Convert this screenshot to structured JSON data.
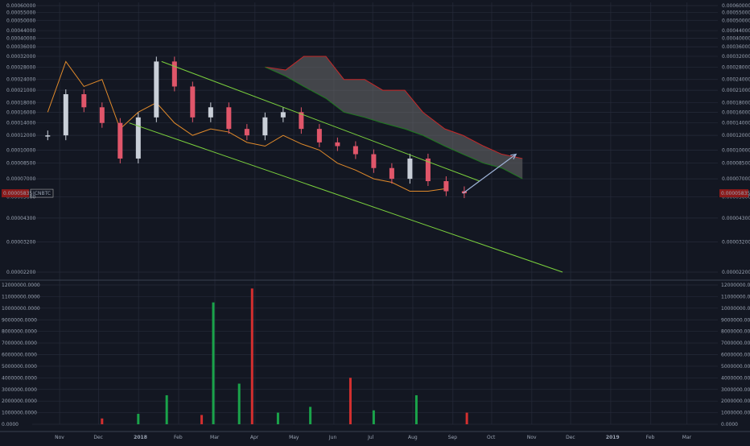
{
  "symbol": "ICNBTC",
  "last_price_label": "0.00005835",
  "colors": {
    "background": "#131722",
    "grid": "#262b3a",
    "bull": "#1aa34a",
    "bear": "#d32f2f",
    "candle_bull": "#c9cfd8",
    "candle_bear": "#e0566a",
    "orange_line": "#e08a2b",
    "trendline": "#7bd13d",
    "cloud_fill": "#6b6b6b",
    "cloud_edge_upper": "#c62828",
    "cloud_edge_lower": "#1e7a1e",
    "projection_arrow": "#9fb4d8",
    "price_badge": "#8b1a1a"
  },
  "chart_data": [
    {
      "type": "line",
      "panel": "price",
      "scale": "log",
      "ylim": [
        2.2e-05,
        6e-05
      ],
      "y_ticks": [
        "0.00060000",
        "0.00055000",
        "0.00050000",
        "0.00044000",
        "0.00040000",
        "0.00036000",
        "0.00032000",
        "0.00028000",
        "0.00024000",
        "0.00021000",
        "0.00018000",
        "0.00016000",
        "0.00014000",
        "0.00012000",
        "0.00010000",
        "0.00008500",
        "0.00007000",
        "0.00005600",
        "0.00004300",
        "0.00003200",
        "0.00002200"
      ],
      "x_ticks": [
        "Nov",
        "Dec",
        "2018",
        "Feb",
        "Mar",
        "Apr",
        "May",
        "Jun",
        "Jul",
        "Aug",
        "Sep",
        "Oct",
        "Nov",
        "Dec",
        "2019",
        "Feb",
        "Mar"
      ],
      "series": [
        {
          "kind": "candles",
          "x": [
            "2017-10-29",
            "2017-11-12",
            "2017-11-26",
            "2017-12-10",
            "2017-12-24",
            "2018-01-07",
            "2018-01-21",
            "2018-02-04",
            "2018-02-18",
            "2018-03-04",
            "2018-03-18",
            "2018-04-01",
            "2018-04-15",
            "2018-04-29",
            "2018-05-13",
            "2018-05-27",
            "2018-06-10",
            "2018-06-24",
            "2018-07-08",
            "2018-07-22",
            "2018-08-05",
            "2018-08-19",
            "2018-09-02",
            "2018-09-16"
          ],
          "values": [
            0.00012,
            0.0002,
            0.00017,
            0.00014,
            9e-05,
            0.00015,
            0.0003,
            0.00022,
            0.00015,
            0.00017,
            0.00013,
            0.00012,
            0.00015,
            0.00016,
            0.00013,
            0.00011,
            0.000105,
            9.5e-05,
            8e-05,
            7e-05,
            9e-05,
            6.8e-05,
            6e-05,
            5.85e-05
          ]
        },
        {
          "kind": "line",
          "x": [
            "2017-10-29",
            "2017-11-12",
            "2017-11-26",
            "2017-12-10",
            "2017-12-24",
            "2018-01-07",
            "2018-01-21",
            "2018-02-04",
            "2018-02-18",
            "2018-03-04",
            "2018-03-18",
            "2018-04-01",
            "2018-04-15",
            "2018-04-29",
            "2018-05-13",
            "2018-05-27",
            "2018-06-10",
            "2018-06-24",
            "2018-07-08",
            "2018-07-22",
            "2018-08-05",
            "2018-08-19",
            "2018-09-02"
          ],
          "values": [
            0.00016,
            0.0003,
            0.00022,
            0.00024,
            0.00013,
            0.00016,
            0.00018,
            0.00014,
            0.00012,
            0.00013,
            0.000125,
            0.00011,
            0.000105,
            0.00012,
            0.000108,
            0.0001,
            8.5e-05,
            7.8e-05,
            7e-05,
            6.7e-05,
            6e-05,
            6e-05,
            6.2e-05
          ]
        },
        {
          "kind": "cloud",
          "x": [
            "2018-04-15",
            "2018-05-01",
            "2018-05-15",
            "2018-06-01",
            "2018-06-15",
            "2018-07-01",
            "2018-07-15",
            "2018-08-01",
            "2018-08-15",
            "2018-09-01",
            "2018-09-15",
            "2018-10-01",
            "2018-10-15",
            "2018-10-31"
          ],
          "upper": [
            0.00028,
            0.00027,
            0.00032,
            0.00032,
            0.00024,
            0.00024,
            0.00021,
            0.00021,
            0.00016,
            0.00013,
            0.00012,
            0.000105,
            9.5e-05,
            9e-05
          ],
          "lower": [
            0.00028,
            0.00025,
            0.00022,
            0.00019,
            0.00016,
            0.00015,
            0.00014,
            0.00013,
            0.00012,
            0.000105,
            9.5e-05,
            8.5e-05,
            8e-05,
            7e-05
          ]
        },
        {
          "kind": "trendline",
          "x": [
            "2018-01-25",
            "2018-09-28"
          ],
          "values": [
            0.0003,
            6.8e-05
          ]
        },
        {
          "kind": "trendline",
          "x": [
            "2017-12-31",
            "2018-12-01"
          ],
          "values": [
            0.00014,
            2.2e-05
          ]
        },
        {
          "kind": "arrow",
          "x": [
            "2018-09-15",
            "2018-10-26"
          ],
          "values": [
            5.85e-05,
            9.5e-05
          ]
        }
      ]
    },
    {
      "type": "bar",
      "panel": "volume",
      "ylim": [
        0,
        12000000
      ],
      "y_ticks": [
        "12000000.0000",
        "11000000.0000",
        "10000000.0000",
        "9000000.0000",
        "8000000.0000",
        "7000000.0000",
        "6000000.0000",
        "5000000.0000",
        "4000000.0000",
        "3000000.0000",
        "2000000.0000",
        "1000000.0000",
        "0.0000"
      ],
      "x": [
        "2017-12-10",
        "2018-01-07",
        "2018-01-29",
        "2018-02-25",
        "2018-03-06",
        "2018-03-26",
        "2018-04-05",
        "2018-04-25",
        "2018-05-20",
        "2018-06-20",
        "2018-07-08",
        "2018-08-10",
        "2018-09-18"
      ],
      "values": [
        500000,
        900000,
        2500000,
        800000,
        10500000,
        3500000,
        11700000,
        1000000,
        1500000,
        4000000,
        1200000,
        2500000,
        1000000
      ],
      "series": [
        {
          "values": []
        }
      ]
    }
  ]
}
